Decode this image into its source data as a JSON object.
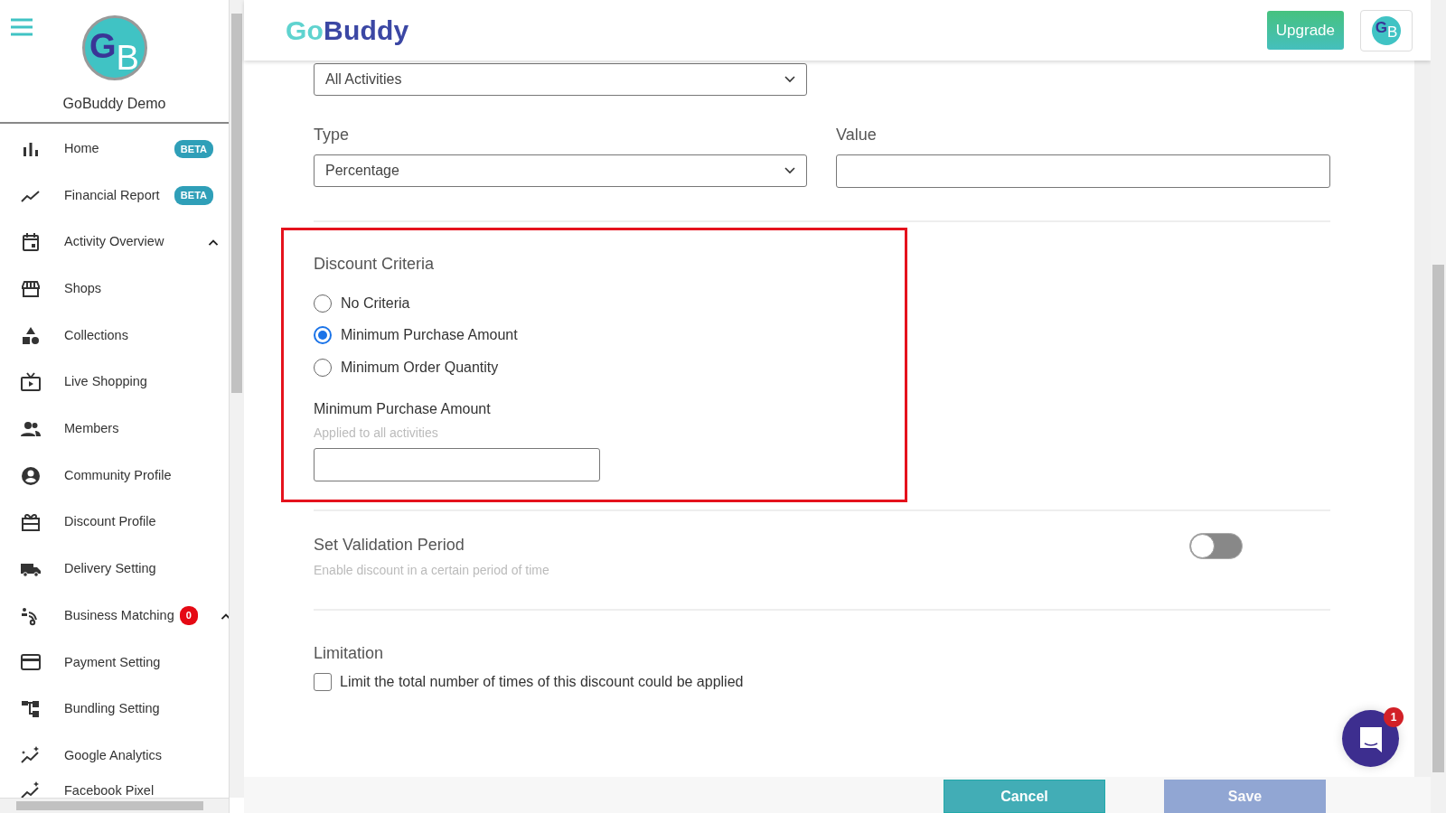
{
  "sidebar": {
    "initials": [
      "G",
      "B"
    ],
    "profile_name": "GoBuddy Demo",
    "items": [
      {
        "label": "Home",
        "badge": {
          "kind": "beta",
          "text": "BETA"
        }
      },
      {
        "label": "Financial Report",
        "badge": {
          "kind": "beta",
          "text": "BETA"
        }
      },
      {
        "label": "Activity Overview",
        "expanded": true
      },
      {
        "label": "Shops"
      },
      {
        "label": "Collections"
      },
      {
        "label": "Live Shopping"
      },
      {
        "label": "Members"
      },
      {
        "label": "Community Profile"
      },
      {
        "label": "Discount Profile"
      },
      {
        "label": "Delivery Setting"
      },
      {
        "label": "Business Matching",
        "badge": {
          "kind": "count",
          "text": "0"
        },
        "expanded": true
      },
      {
        "label": "Payment Setting"
      },
      {
        "label": "Bundling Setting"
      },
      {
        "label": "Google Analytics"
      },
      {
        "label": "Facebook Pixel"
      }
    ]
  },
  "header": {
    "logo": {
      "first": "Go",
      "second": "Buddy"
    },
    "upgrade": "Upgrade",
    "initials": [
      "G",
      "B"
    ]
  },
  "form": {
    "scope": {
      "value": "All Activities"
    },
    "type": {
      "label": "Type",
      "value": "Percentage"
    },
    "value": {
      "label": "Value"
    },
    "criteria": {
      "title": "Discount Criteria",
      "highlighted": true,
      "options": [
        {
          "label": "No Criteria",
          "selected": false
        },
        {
          "label": "Minimum Purchase Amount",
          "selected": true
        },
        {
          "label": "Minimum Order Quantity",
          "selected": false
        }
      ],
      "amount": {
        "label": "Minimum Purchase Amount",
        "hint": "Applied to all activities"
      }
    },
    "validation": {
      "title": "Set Validation Period",
      "hint": "Enable discount in a certain period of time",
      "on": false
    },
    "limitation": {
      "title": "Limitation",
      "label": "Limit the total number of times of this discount could be applied",
      "checked": false
    }
  },
  "footer": {
    "buttons": [
      {
        "label": "Cancel",
        "kind": "cancel",
        "disabled": false
      },
      {
        "label": "Save",
        "kind": "save",
        "disabled": true
      }
    ]
  },
  "chat": {
    "count": "1"
  }
}
